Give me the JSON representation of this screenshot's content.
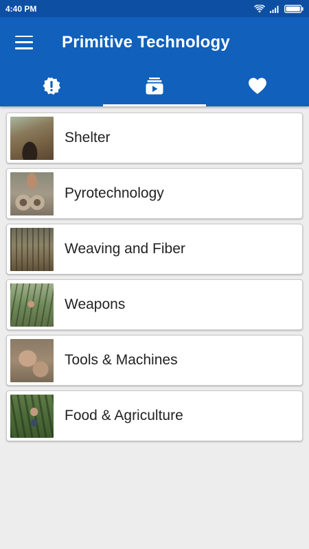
{
  "status_bar": {
    "time": "4:40 PM",
    "icons": [
      "wifi-icon",
      "signal-icon",
      "battery-icon"
    ]
  },
  "app_bar": {
    "title": "Primitive Technology",
    "menu_icon": "hamburger-menu-icon",
    "background": "#1160bb"
  },
  "tabs": [
    {
      "icon": "alert-badge-icon",
      "active": false
    },
    {
      "icon": "video-library-icon",
      "active": true
    },
    {
      "icon": "heart-icon",
      "active": false
    }
  ],
  "categories": [
    {
      "label": "Shelter",
      "thumb": "shelter-thumbnail"
    },
    {
      "label": "Pyrotechnology",
      "thumb": "pyrotechnology-thumbnail"
    },
    {
      "label": "Weaving and Fiber",
      "thumb": "weaving-thumbnail"
    },
    {
      "label": "Weapons",
      "thumb": "weapons-thumbnail"
    },
    {
      "label": "Tools & Machines",
      "thumb": "tools-thumbnail"
    },
    {
      "label": "Food & Agriculture",
      "thumb": "food-thumbnail"
    }
  ]
}
